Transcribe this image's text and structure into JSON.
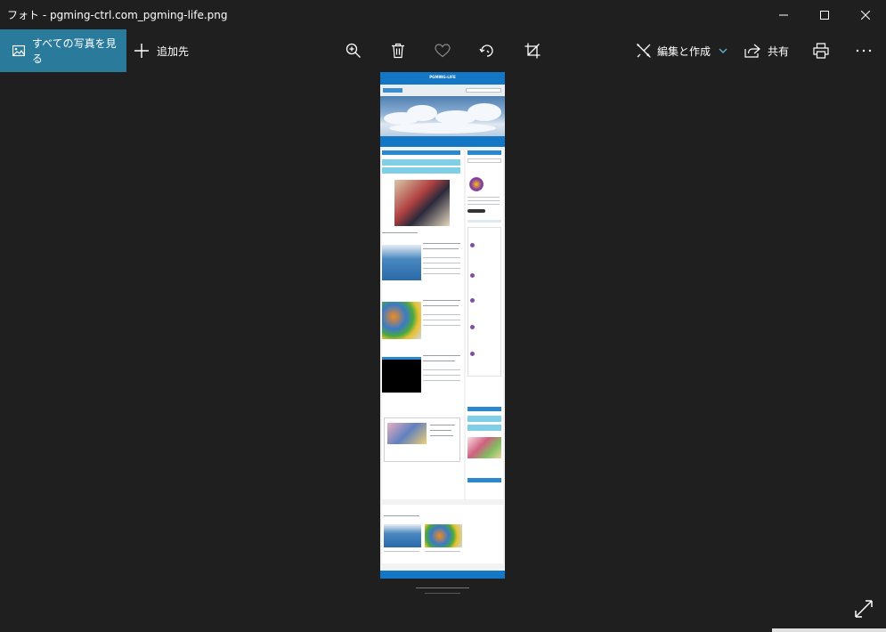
{
  "window": {
    "title": "フォト - pgming-ctrl.com_pgming-life.png"
  },
  "toolbar": {
    "see_all_label": "すべての写真を見る",
    "add_to_label": "追加先",
    "edit_create_label": "編集と作成",
    "share_label": "共有"
  },
  "icons": {
    "zoom": "zoom-in-icon",
    "delete": "trash-icon",
    "favorite": "heart-icon",
    "rotate": "rotate-icon",
    "crop": "crop-icon",
    "print": "printer-icon",
    "more": "more-icon",
    "expand": "expand-icon"
  },
  "colors": {
    "accent": "#2a7a9c",
    "background": "#1f1f1f",
    "site_blue": "#1377c5"
  },
  "photo": {
    "site_title": "PGMING-LIFE"
  }
}
